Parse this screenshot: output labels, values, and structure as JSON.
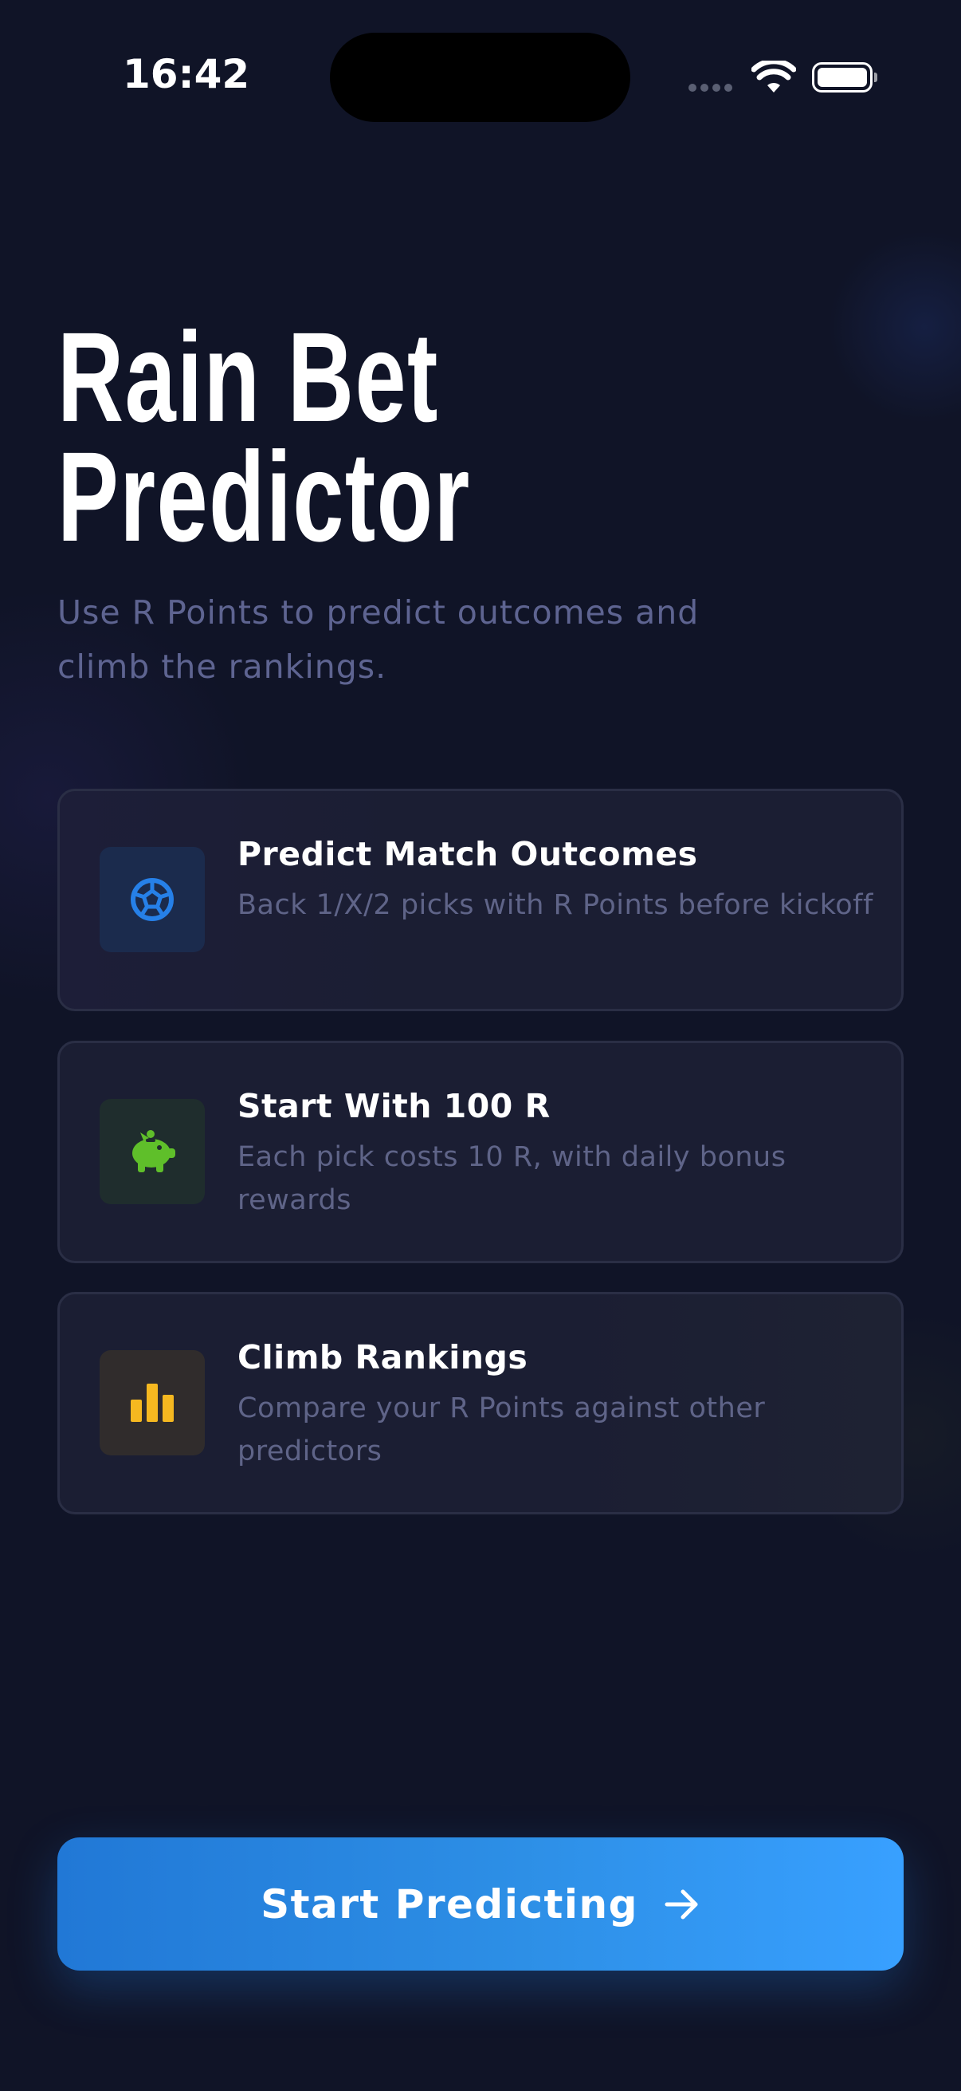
{
  "status_bar": {
    "time": "16:42",
    "icons": [
      "cellular-signal-icon",
      "wifi-icon",
      "battery-icon"
    ]
  },
  "hero": {
    "title_line1": "Rain Bet",
    "title_line2": "Predictor",
    "subtitle": "Use R Points to predict outcomes and climb the rankings."
  },
  "features": [
    {
      "icon": "soccer-ball-icon",
      "icon_color": "#2680e8",
      "title": "Predict Match Outcomes",
      "description": "Back 1/X/2 picks with R Points before kickoff"
    },
    {
      "icon": "piggy-bank-icon",
      "icon_color": "#5fbf2a",
      "title": "Start With 100 R",
      "description": "Each pick costs 10 R, with daily bonus rewards"
    },
    {
      "icon": "bar-chart-icon",
      "icon_color": "#f5b820",
      "title": "Climb Rankings",
      "description": "Compare your R Points against other predictors"
    }
  ],
  "cta": {
    "label": "Start Predicting",
    "icon": "arrow-right-icon"
  },
  "colors": {
    "background": "#101427",
    "card": "#1b1e33",
    "accent": "#2d8fe6"
  }
}
